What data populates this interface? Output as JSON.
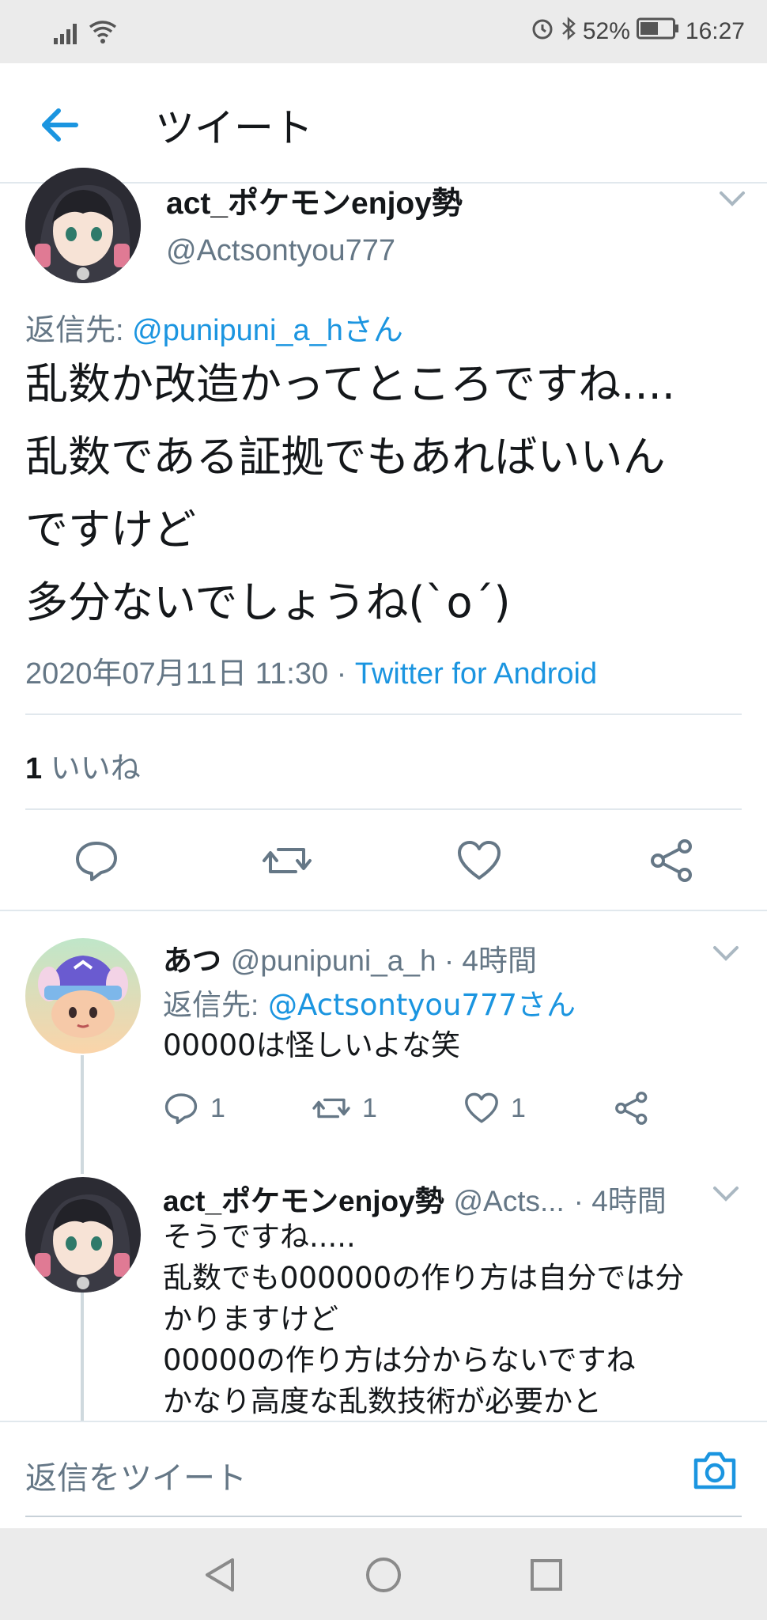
{
  "status_bar": {
    "battery": "52%",
    "time": "16:27"
  },
  "header": {
    "title": "ツイート"
  },
  "main_tweet": {
    "name": "act_ポケモンenjoy勢",
    "handle": "@Actsontyou777",
    "reply_prefix": "返信先:",
    "reply_to": "@punipuni_a_hさん",
    "lines": [
      "乱数か改造かってところですね....",
      "乱数である証拠でもあればいいん",
      "ですけど",
      "多分ないでしょうね(`o´)"
    ],
    "timestamp": "2020年07月11日 11:30 ·",
    "source": "Twitter for Android",
    "likes_count": "1",
    "likes_label": "いいね"
  },
  "replies": [
    {
      "name": "あつ",
      "handle": "@punipuni_a_h · 4時間",
      "reply_prefix": "返信先:",
      "reply_to": "@Actsontyou777さん",
      "lines": [
        "00000は怪しいよな笑"
      ],
      "reply_count": "1",
      "retweet_count": "1",
      "like_count": "1"
    },
    {
      "name": "act_ポケモンenjoy勢",
      "handle": "@Acts...",
      "time": "· 4時間",
      "lines": [
        "そうですね.....",
        "乱数でも000000の作り方は自分では分",
        "かりますけど",
        "00000の作り方は分からないですね",
        "かなり高度な乱数技術が必要かと"
      ]
    }
  ],
  "reply_bar": {
    "placeholder": "返信をツイート"
  },
  "icons": {
    "back": "arrow-left-icon",
    "reply": "speech-bubble-icon",
    "retweet": "retweet-icon",
    "like": "heart-icon",
    "share": "share-icon",
    "camera": "camera-icon",
    "chevron": "chevron-down-icon"
  },
  "colors": {
    "accent": "#1b95e0",
    "muted": "#657786",
    "divider": "#e1e8ed"
  }
}
